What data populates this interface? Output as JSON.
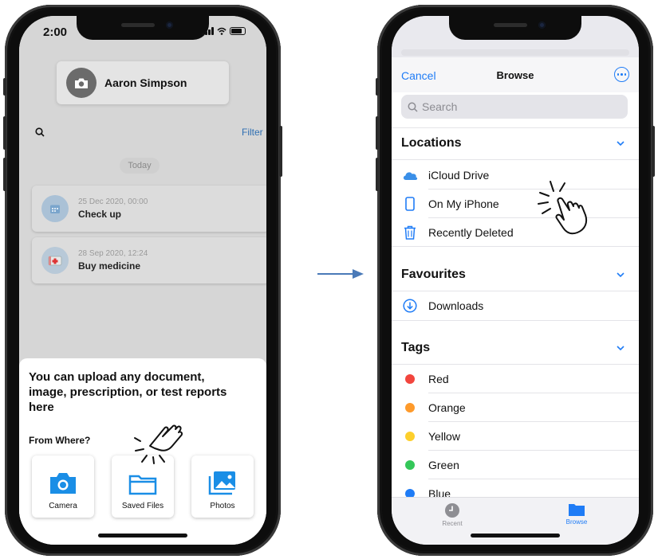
{
  "left_screen": {
    "status_time": "2:00",
    "profile": {
      "name": "Aaron Simpson",
      "icon": "camera-icon"
    },
    "search": {
      "icon": "search-icon",
      "filter_label": "Filter"
    },
    "today_label": "Today",
    "events": [
      {
        "date": "25 Dec 2020, 00:00",
        "title": "Check up",
        "icon": "calendar-icon"
      },
      {
        "date": "28 Sep 2020, 12:24",
        "title": "Buy medicine",
        "icon": "medical-kit-icon"
      }
    ],
    "sheet": {
      "title": "You can upload any document, image, prescription, or test reports here",
      "subtitle": "From Where?",
      "options": [
        {
          "label": "Camera",
          "icon": "camera-icon"
        },
        {
          "label": "Saved Files",
          "icon": "folder-icon"
        },
        {
          "label": "Photos",
          "icon": "photos-icon"
        }
      ]
    }
  },
  "right_screen": {
    "nav": {
      "cancel_label": "Cancel",
      "title": "Browse",
      "more_icon": "ellipsis-circle-icon"
    },
    "search_placeholder": "Search",
    "sections": {
      "locations": {
        "title": "Locations",
        "items": [
          {
            "label": "iCloud Drive",
            "icon": "cloud-icon"
          },
          {
            "label": "On My iPhone",
            "icon": "iphone-icon"
          },
          {
            "label": "Recently Deleted",
            "icon": "trash-icon"
          }
        ]
      },
      "favourites": {
        "title": "Favourites",
        "items": [
          {
            "label": "Downloads",
            "icon": "download-icon"
          }
        ]
      },
      "tags": {
        "title": "Tags",
        "items": [
          {
            "label": "Red",
            "color": "#f2453d"
          },
          {
            "label": "Orange",
            "color": "#fe9a2b"
          },
          {
            "label": "Yellow",
            "color": "#fdcf2c"
          },
          {
            "label": "Green",
            "color": "#34c759"
          },
          {
            "label": "Blue",
            "color": "#1f7cf6"
          }
        ]
      }
    },
    "tabbar": {
      "recent_label": "Recent",
      "browse_label": "Browse"
    }
  },
  "colors": {
    "accent": "#1f7cf6",
    "filter": "#2f6fb2",
    "arrow": "#4a7ab8"
  }
}
